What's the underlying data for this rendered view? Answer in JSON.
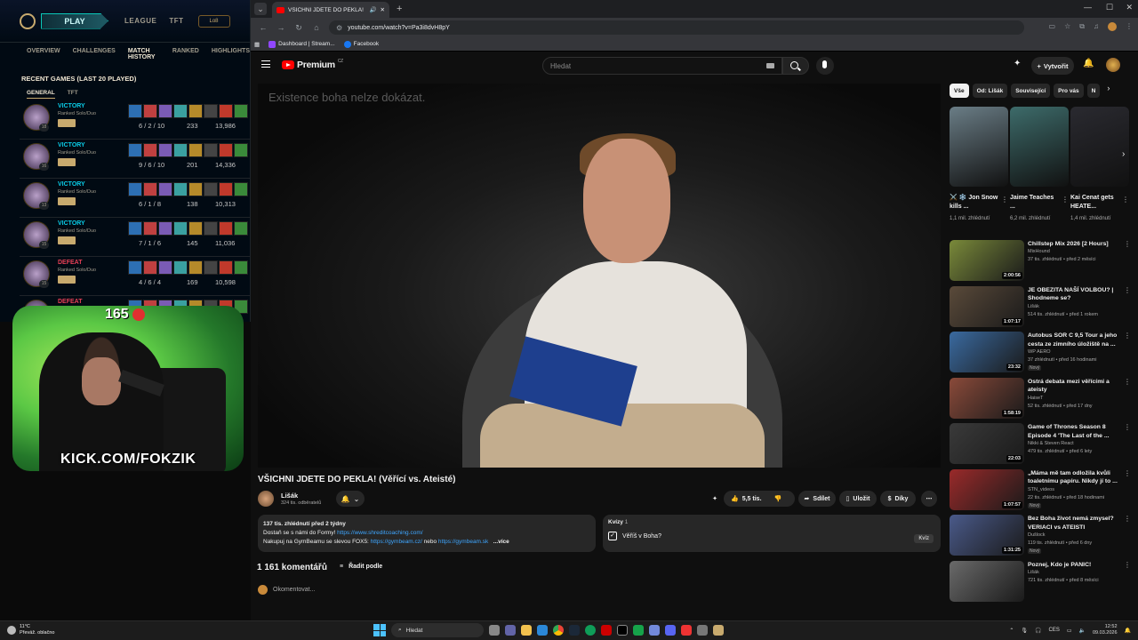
{
  "lol": {
    "play_label": "PLAY",
    "nav": [
      "LEAGUE",
      "TFT"
    ],
    "level_badge": "Lo8",
    "subnav": [
      "OVERVIEW",
      "CHALLENGES",
      "MATCH HISTORY",
      "RANKED",
      "HIGHLIGHTS"
    ],
    "recent_title": "RECENT GAMES (LAST 20 PLAYED)",
    "tabs": [
      "GENERAL",
      "TFT"
    ],
    "games": [
      {
        "result": "VICTORY",
        "mode": "Ranked Solo/Duo",
        "kda": "6 / 2 / 10",
        "cs": "233",
        "gold": "13,986",
        "level": "18",
        "color": "#0acbe6"
      },
      {
        "result": "VICTORY",
        "mode": "Ranked Solo/Duo",
        "kda": "9 / 6 / 10",
        "cs": "201",
        "gold": "14,336",
        "level": "16",
        "color": "#0acbe6"
      },
      {
        "result": "VICTORY",
        "mode": "Ranked Solo/Duo",
        "kda": "6 / 1 / 8",
        "cs": "138",
        "gold": "10,313",
        "level": "13",
        "color": "#0acbe6"
      },
      {
        "result": "VICTORY",
        "mode": "Ranked Solo/Duo",
        "kda": "7 / 1 / 6",
        "cs": "145",
        "gold": "11,036",
        "level": "15",
        "color": "#0acbe6"
      },
      {
        "result": "DEFEAT",
        "mode": "Ranked Solo/Duo",
        "kda": "4 / 6 / 4",
        "cs": "169",
        "gold": "10,598",
        "level": "15",
        "color": "#e84057"
      },
      {
        "result": "DEFEAT",
        "mode": "",
        "kda": "",
        "cs": "",
        "gold": "",
        "level": "",
        "color": "#e84057"
      }
    ]
  },
  "stream": {
    "sub_count": "165",
    "kick_url": "KICK.COM/FOKZIK"
  },
  "browser": {
    "tab_title": "VŠICHNI JDETE DO PEKLA!",
    "url": "youtube.com/watch?v=Pa3i8dvH8pY",
    "bookmarks": [
      "Dashboard | Stream...",
      "Facebook"
    ]
  },
  "youtube": {
    "logo_text": "Premium",
    "logo_region": "CZ",
    "search_placeholder": "Hledat",
    "create_label": "Vytvořit",
    "video_caption": "Existence boha nelze dokázat.",
    "video_title": "VŠICHNI JDETE DO PEKLA! (Věřící vs. Ateisté)",
    "channel_name": "Lišák",
    "channel_subs": "324 tis. odběratelů",
    "likes": "5,5 tis.",
    "share_label": "Sdílet",
    "save_label": "Uložit",
    "thanks_label": "Díky",
    "desc_stats": "137 tis. zhlédnutí  před 2 týdny",
    "desc_line1_text": "Dostaň se s námi do Formy! ",
    "desc_line1_link": "https://www.shreditcoaching.com/",
    "desc_line2_text": "Nakupuj na GymBeamu se slevou FOX5: ",
    "desc_line2_link1": "https://gymbeam.cz/",
    "desc_line2_mid": " nebo ",
    "desc_line2_link2": "https://gymbeam.sk",
    "desc_more": "...více",
    "quiz_header": "Kvízy",
    "quiz_count": "1",
    "quiz_question": "Věříš v Boha?",
    "quiz_tag": "Kvíz",
    "comments_count": "1 161 komentářů",
    "sort_label": "Řadit podle",
    "add_comment": "Okomentovat...",
    "chips": [
      "Vše",
      "Od: Lišák",
      "Související",
      "Pro vás",
      "N"
    ],
    "shorts": [
      {
        "title": "⚔️ ❄️ Jon Snow kills ...",
        "views": "1,1 mil. zhlédnutí",
        "thumb": "#6a7d86"
      },
      {
        "title": "Jaime Teaches ...",
        "views": "6,2 mil. zhlédnutí",
        "thumb": "#3d6b6a"
      },
      {
        "title": "Kai Cenat gets HEATE...",
        "views": "1,4 mil. zhlédnutí",
        "thumb": "#2a2a30"
      }
    ],
    "recs": [
      {
        "title": "Chillstep Mix 2026 [2 Hours]",
        "channel": "MixHound",
        "meta": "37 tis. zhlédnutí • před 2 měsíci",
        "duration": "2:00:56",
        "thumb": "#7a8a3a",
        "new": ""
      },
      {
        "title": "JE OBEZITA NAŠÍ VOLBOU? | Shodneme se?",
        "channel": "Lišák",
        "meta": "514 tis. zhlédnutí • před 1 rokem",
        "duration": "1:07:17",
        "thumb": "#5a4a3a",
        "new": ""
      },
      {
        "title": "Autobus SOR C 9,5 Tour a jeho cesta ze zimního úložiště na ...",
        "channel": "WP AERO",
        "meta": "37 zhlédnutí • před 16 hodinami",
        "duration": "23:32",
        "thumb": "#3a6aa0",
        "new": "Nový"
      },
      {
        "title": "Ostrá debata mezi věřícími a ateisty",
        "channel": "HaiseT",
        "meta": "52 tis. zhlédnutí • před 17 dny",
        "duration": "1:58:19",
        "thumb": "#8a4a3a",
        "new": ""
      },
      {
        "title": "Game of Thrones Season 8 Episode 4 'The Last of the ...",
        "channel": "Nikki & Steven React",
        "meta": "479 tis. zhlédnutí • před 6 lety",
        "duration": "22:03",
        "thumb": "#3a3a3a",
        "new": ""
      },
      {
        "title": "„Máma mě tam odložila kvůli toaletnímu papíru. Nikdy jí to ...",
        "channel": "STN_videos",
        "meta": "22 tis. zhlédnutí • před 18 hodinami",
        "duration": "1:07:57",
        "thumb": "#9a2a2a",
        "new": "Nový"
      },
      {
        "title": "Bez Boha život nemá zmysel? VERIACI vs ATEISTI",
        "channel": "Dušlock",
        "meta": "119 tis. zhlédnutí • před 6 dny",
        "duration": "1:31:25",
        "thumb": "#4a5a8a",
        "new": "Nový"
      },
      {
        "title": "Poznej, Kdo je PANIC!",
        "channel": "Lišák",
        "meta": "721 tis. zhlédnutí • před 8 měsíci",
        "duration": "",
        "thumb": "#6a6a6a",
        "new": ""
      }
    ]
  },
  "taskbar": {
    "temp": "11°C",
    "weather": "Převáž. oblačno",
    "search": "Hledat",
    "lang": "CES",
    "time": "12:52",
    "date": "09.03.2026"
  }
}
